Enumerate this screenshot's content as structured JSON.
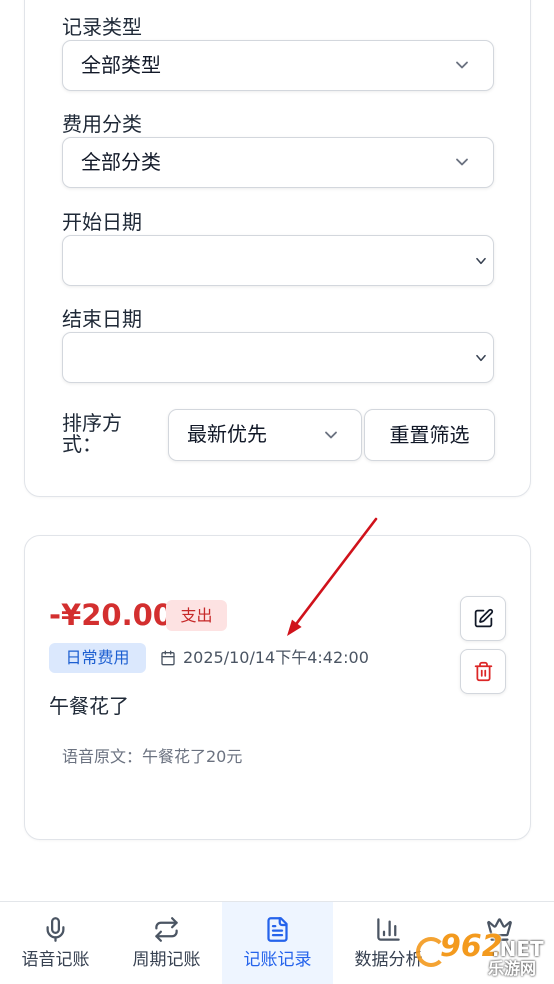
{
  "filters": {
    "record_type": {
      "label": "记录类型",
      "value": "全部类型"
    },
    "category": {
      "label": "费用分类",
      "value": "全部分类"
    },
    "start_date": {
      "label": "开始日期",
      "value": ""
    },
    "end_date": {
      "label": "结束日期",
      "value": ""
    },
    "sort": {
      "label": "排序方式：",
      "value": "最新优先"
    },
    "reset_label": "重置筛选"
  },
  "record": {
    "amount": "-¥20.00",
    "type_badge": "支出",
    "category_badge": "日常费用",
    "datetime": "2025/10/14下午4:42:00",
    "note": "午餐花了",
    "voice_original": "语音原文：午餐花了20元",
    "icons": {
      "date": "calendar-icon",
      "edit": "edit-icon",
      "delete": "trash-icon"
    }
  },
  "nav": {
    "tabs": [
      {
        "label": "语音记账",
        "icon": "mic-icon",
        "active": false
      },
      {
        "label": "周期记账",
        "icon": "repeat-icon",
        "active": false
      },
      {
        "label": "记账记录",
        "icon": "file-text-icon",
        "active": true
      },
      {
        "label": "数据分析",
        "icon": "bar-chart-icon",
        "active": false
      },
      {
        "icon": "crown-icon",
        "active": false
      }
    ]
  },
  "watermark": {
    "number": "962",
    "domain": ".NET",
    "name": "乐游网"
  },
  "colors": {
    "accent": "#2563eb",
    "expense_red": "#d32f2f",
    "expense_badge_bg": "#fde2e2",
    "category_badge_bg": "#dbe8fd",
    "annotation_arrow": "#d0121b"
  }
}
